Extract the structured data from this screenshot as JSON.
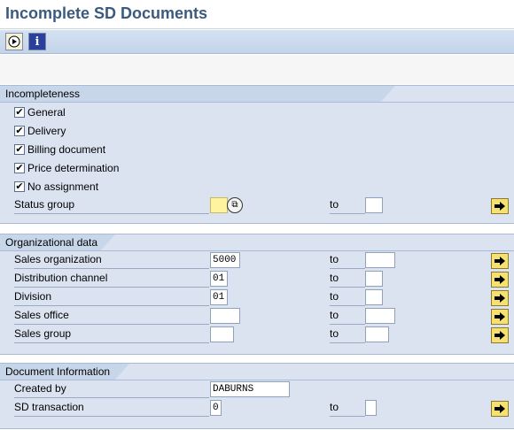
{
  "window": {
    "title": "Incomplete SD Documents"
  },
  "toolbar": {
    "execute_icon": "execute-icon",
    "info_icon": "info-icon",
    "info_glyph": "i"
  },
  "incompleteness": {
    "title": "Incompleteness",
    "checkboxes": [
      {
        "label": "General",
        "checked": true
      },
      {
        "label": "Delivery",
        "checked": true
      },
      {
        "label": "Billing document",
        "checked": true
      },
      {
        "label": "Price determination",
        "checked": true
      },
      {
        "label": "No assignment",
        "checked": true
      }
    ],
    "status_group": {
      "label": "Status group",
      "from": "",
      "to_label": "to",
      "to": ""
    }
  },
  "org_data": {
    "title": "Organizational data",
    "rows": [
      {
        "label": "Sales organization",
        "from": "5000",
        "to_label": "to",
        "to": ""
      },
      {
        "label": "Distribution channel",
        "from": "01",
        "to_label": "to",
        "to": ""
      },
      {
        "label": "Division",
        "from": "01",
        "to_label": "to",
        "to": ""
      },
      {
        "label": "Sales office",
        "from": "",
        "to_label": "to",
        "to": ""
      },
      {
        "label": "Sales group",
        "from": "",
        "to_label": "to",
        "to": ""
      }
    ]
  },
  "doc_info": {
    "title": "Document Information",
    "created_by": {
      "label": "Created by",
      "value": "DABURNS"
    },
    "sd_transaction": {
      "label": "SD transaction",
      "from": "0",
      "to_label": "to",
      "to": ""
    }
  },
  "colors": {
    "title": "#3a5a7f",
    "group_bg": "#dbe3f0",
    "required_field": "#fff3a0",
    "multi_button": "#f5e070"
  }
}
